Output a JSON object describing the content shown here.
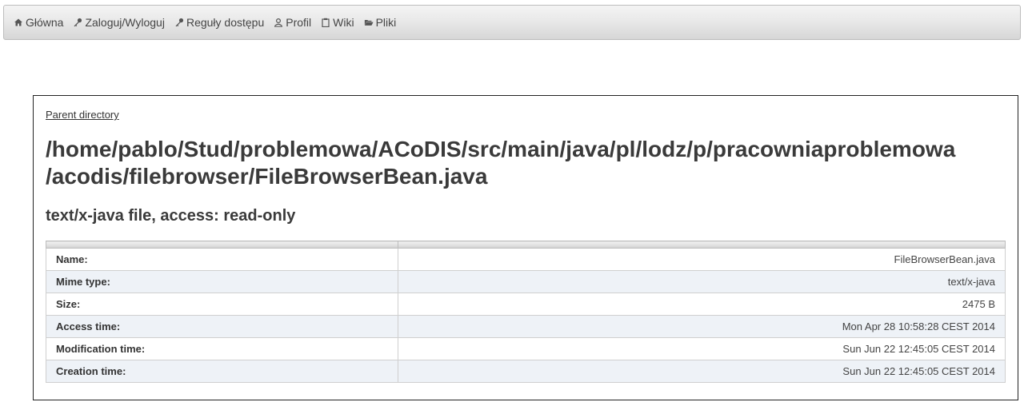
{
  "nav": {
    "items": [
      {
        "label": "Główna",
        "icon": "home-icon"
      },
      {
        "label": "Zaloguj/Wyloguj",
        "icon": "key-icon"
      },
      {
        "label": "Reguły dostępu",
        "icon": "key-icon"
      },
      {
        "label": "Profil",
        "icon": "user-icon"
      },
      {
        "label": "Wiki",
        "icon": "clipboard-icon"
      },
      {
        "label": "Pliki",
        "icon": "folder-open-icon"
      }
    ]
  },
  "panel": {
    "parent_link": "Parent directory",
    "path_line1": "/home/pablo/Stud/problemowa/ACoDIS/src/main/java/pl/lodz/p/pracowniaproblemowa",
    "path_line2": "/acodis/filebrowser/FileBrowserBean.java",
    "subtitle": "text/x-java file, access: read-only"
  },
  "table": {
    "rows": [
      {
        "label": "Name:",
        "value": "FileBrowserBean.java"
      },
      {
        "label": "Mime type:",
        "value": "text/x-java"
      },
      {
        "label": "Size:",
        "value": "2475 B"
      },
      {
        "label": "Access time:",
        "value": "Mon Apr 28 10:58:28 CEST 2014"
      },
      {
        "label": "Modification time:",
        "value": "Sun Jun 22 12:45:05 CEST 2014"
      },
      {
        "label": "Creation time:",
        "value": "Sun Jun 22 12:45:05 CEST 2014"
      }
    ]
  }
}
